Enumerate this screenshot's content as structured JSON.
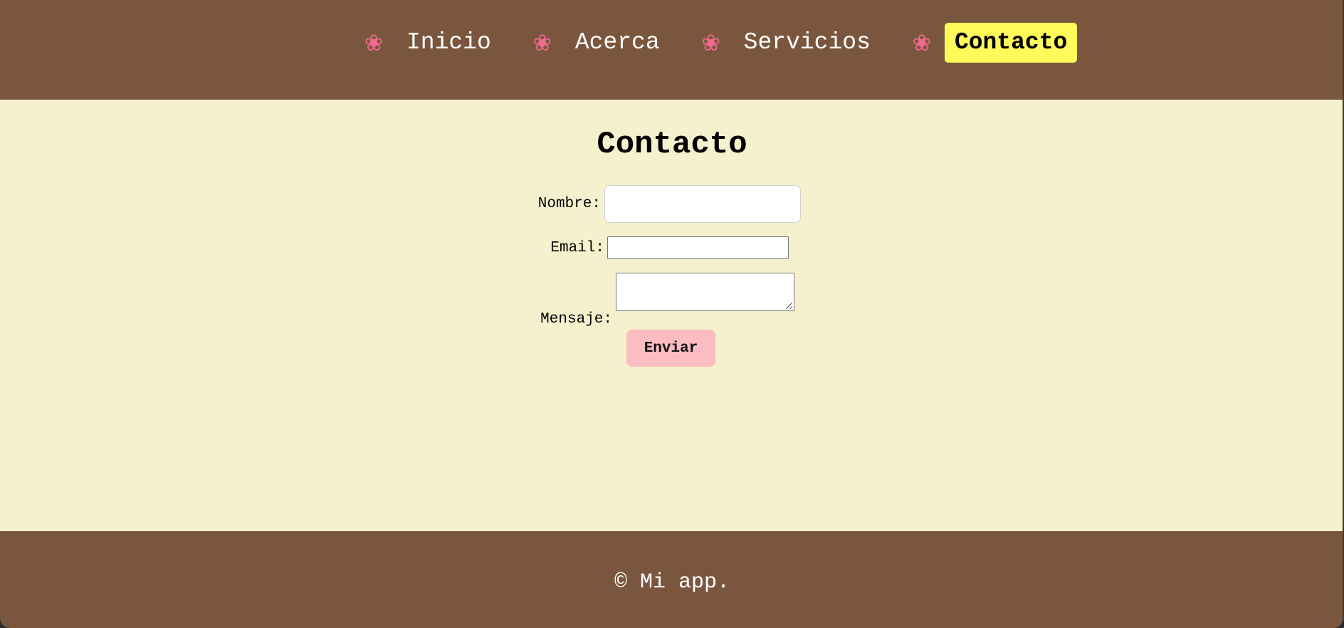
{
  "colors": {
    "header_bg": "#7b563e",
    "main_bg": "#f5f0cd",
    "footer_bg": "#7b563e",
    "nav_active_bg": "#fffb5a",
    "flower": "#f06a8e",
    "button_bg": "#fbbcc2"
  },
  "nav": {
    "icon": "flower-icon",
    "items": [
      {
        "label": "Inicio",
        "active": false
      },
      {
        "label": "Acerca",
        "active": false
      },
      {
        "label": "Servicios",
        "active": false
      },
      {
        "label": "Contacto",
        "active": true
      }
    ]
  },
  "main": {
    "title": "Contacto",
    "form": {
      "nombre_label": "Nombre:",
      "nombre_value": "",
      "email_label": "Email:",
      "email_value": "",
      "mensaje_label": "Mensaje:",
      "mensaje_value": "",
      "submit_label": "Enviar"
    }
  },
  "footer": {
    "text": "© Mi app."
  }
}
